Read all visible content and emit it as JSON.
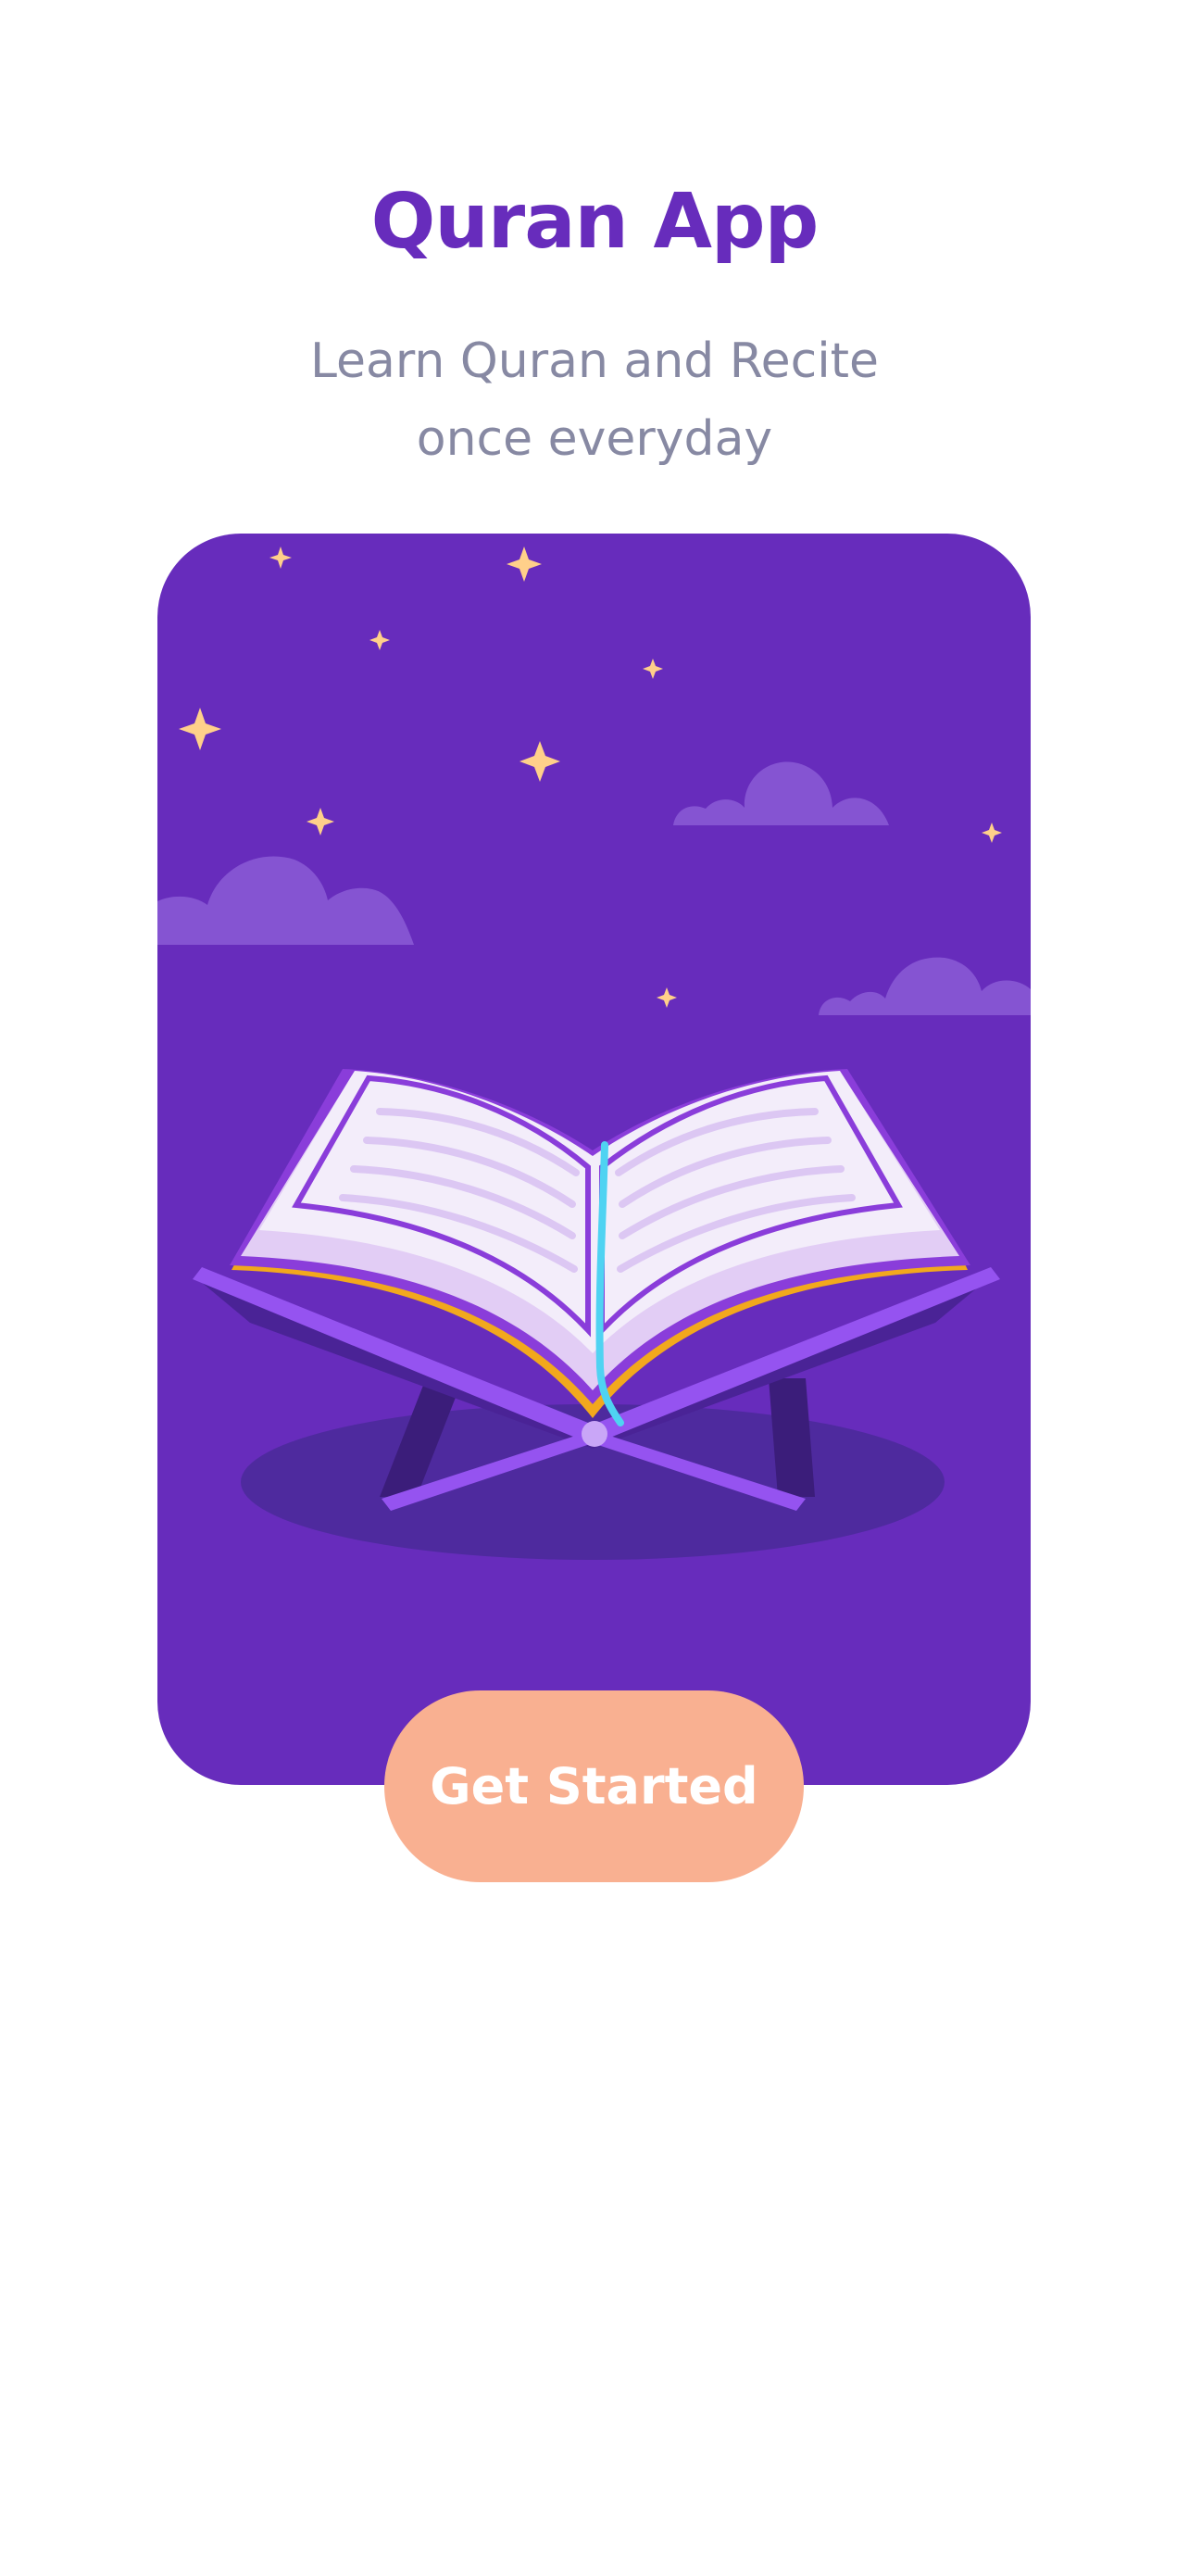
{
  "app": {
    "title": "Quran App",
    "subtitle_line1": "Learn Quran and Recite",
    "subtitle_line2": "once everyday"
  },
  "hero": {
    "illustration": "open-quran-on-stand-night-sky"
  },
  "actions": {
    "get_started_label": "Get Started"
  },
  "colors": {
    "primary": "#672CBC",
    "subtitle": "#8789A3",
    "button": "#F9B091",
    "button_text": "#FFFFFF",
    "star": "#FFD08A",
    "cloud": "#8B5CD6",
    "bookmark": "#4FD3F2",
    "page_edge": "#F2A81D"
  }
}
